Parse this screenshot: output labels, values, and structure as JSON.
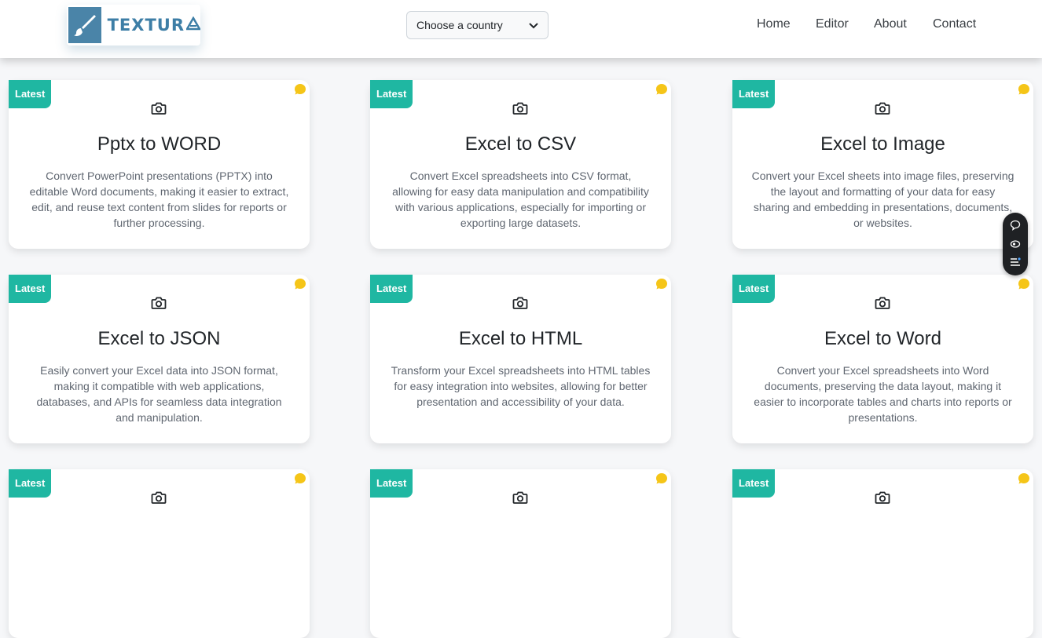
{
  "header": {
    "logo_text": "TEXTUR",
    "country_select": {
      "selected": "Choose a country"
    },
    "nav": [
      "Home",
      "Editor",
      "About",
      "Contact"
    ]
  },
  "colors": {
    "accent": "#1fb7a2",
    "badge_dot": "#f5c518",
    "logo_blue": "#4a84a8"
  },
  "cards": [
    {
      "badge": "Latest",
      "title": "Pptx to WORD",
      "description": "Convert PowerPoint presentations (PPTX) into editable Word documents, making it easier to extract, edit, and reuse text content from slides for reports or further processing."
    },
    {
      "badge": "Latest",
      "title": "Excel to CSV",
      "description": "Convert Excel spreadsheets into CSV format, allowing for easy data manipulation and compatibility with various applications, especially for importing or exporting large datasets."
    },
    {
      "badge": "Latest",
      "title": "Excel to Image",
      "description": "Convert your Excel sheets into image files, preserving the layout and formatting of your data for easy sharing and embedding in presentations, documents, or websites."
    },
    {
      "badge": "Latest",
      "title": "Excel to JSON",
      "description": "Easily convert your Excel data into JSON format, making it compatible with web applications, databases, and APIs for seamless data integration and manipulation."
    },
    {
      "badge": "Latest",
      "title": "Excel to HTML",
      "description": "Transform your Excel spreadsheets into HTML tables for easy integration into websites, allowing for better presentation and accessibility of your data."
    },
    {
      "badge": "Latest",
      "title": "Excel to Word",
      "description": "Convert your Excel spreadsheets into Word documents, preserving the data layout, making it easier to incorporate tables and charts into reports or presentations."
    },
    {
      "badge": "Latest"
    },
    {
      "badge": "Latest"
    },
    {
      "badge": "Latest"
    }
  ]
}
